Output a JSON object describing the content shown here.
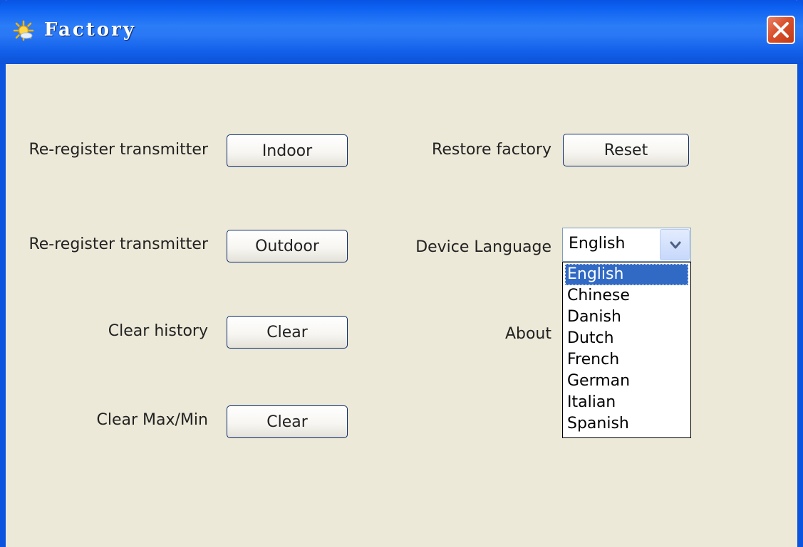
{
  "window": {
    "title": "Factory"
  },
  "rows": {
    "indoor": {
      "label": "Re-register transmitter",
      "button": "Indoor"
    },
    "outdoor": {
      "label": "Re-register transmitter",
      "button": "Outdoor"
    },
    "history": {
      "label": "Clear history",
      "button": "Clear"
    },
    "maxmin": {
      "label": "Clear Max/Min",
      "button": "Clear"
    },
    "restore": {
      "label": "Restore factory",
      "button": "Reset"
    },
    "language": {
      "label": "Device Language",
      "selected": "English"
    },
    "about": {
      "label": "About"
    }
  },
  "language_options": [
    "English",
    "Chinese",
    "Danish",
    "Dutch",
    "French",
    "German",
    "Italian",
    "Spanish"
  ],
  "highlighted_option": "English",
  "icons": {
    "title": "sun-icon",
    "close": "close-icon",
    "dropdown": "chevron-down-icon"
  },
  "colors": {
    "titlebar": "#2b7cf7",
    "close_button": "#d9512c",
    "client_bg": "#ece9d8",
    "selection": "#316ac5"
  }
}
